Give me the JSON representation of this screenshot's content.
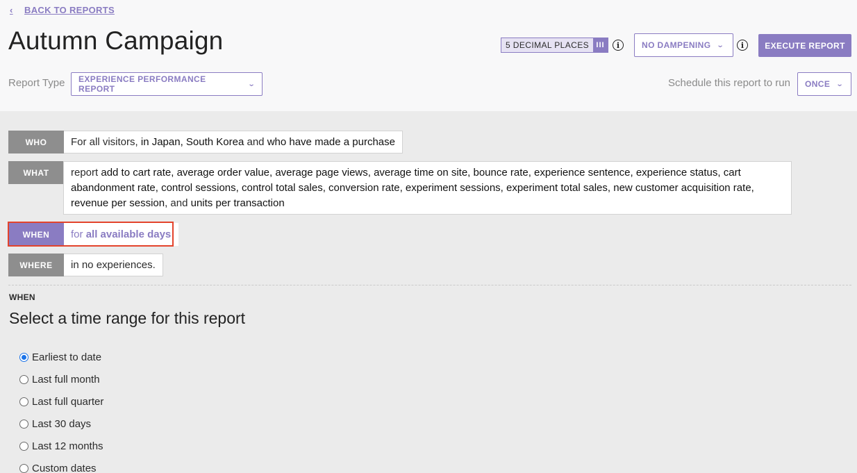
{
  "nav": {
    "back_label": "BACK TO REPORTS"
  },
  "page": {
    "title": "Autumn Campaign"
  },
  "toolbar": {
    "decimal_places_label": "5 DECIMAL PLACES",
    "decimal_handle": "III",
    "dampening_label": "NO DAMPENING",
    "execute_label": "EXECUTE REPORT",
    "info_glyph": "i"
  },
  "report_type": {
    "label": "Report Type",
    "value": "EXPERIENCE PERFORMANCE REPORT"
  },
  "schedule": {
    "label": "Schedule this report to run",
    "value": "ONCE"
  },
  "criteria": {
    "who": {
      "tag": "WHO",
      "pre": "For all visitors, ",
      "b1": "in Japan, South Korea",
      "mid": " and ",
      "b2": "who have made a purchase"
    },
    "what": {
      "tag": "WHAT",
      "pre": "report ",
      "metrics": "add to cart rate, average order value, average page views, average time on site, bounce rate, experience sentence, experience status, cart abandonment rate, control sessions, control total sales, conversion rate, experiment sessions, experiment total sales, new customer acquisition rate, revenue per session",
      "conj": ", and ",
      "last": "units per transaction"
    },
    "when": {
      "tag": "WHEN",
      "pre": "for ",
      "value": "all available days"
    },
    "where": {
      "tag": "WHERE",
      "text": "in no experiences."
    }
  },
  "when_section": {
    "label": "WHEN",
    "title": "Select a time range for this report",
    "options": [
      "Earliest to date",
      "Last full month",
      "Last full quarter",
      "Last 30 days",
      "Last 12 months",
      "Custom dates"
    ],
    "selected": "Earliest to date"
  },
  "colors": {
    "accent": "#8a7cc2",
    "tag_gray": "#8e8e8e",
    "highlight": "#e3432b",
    "radio_selected": "#1a73e8"
  }
}
